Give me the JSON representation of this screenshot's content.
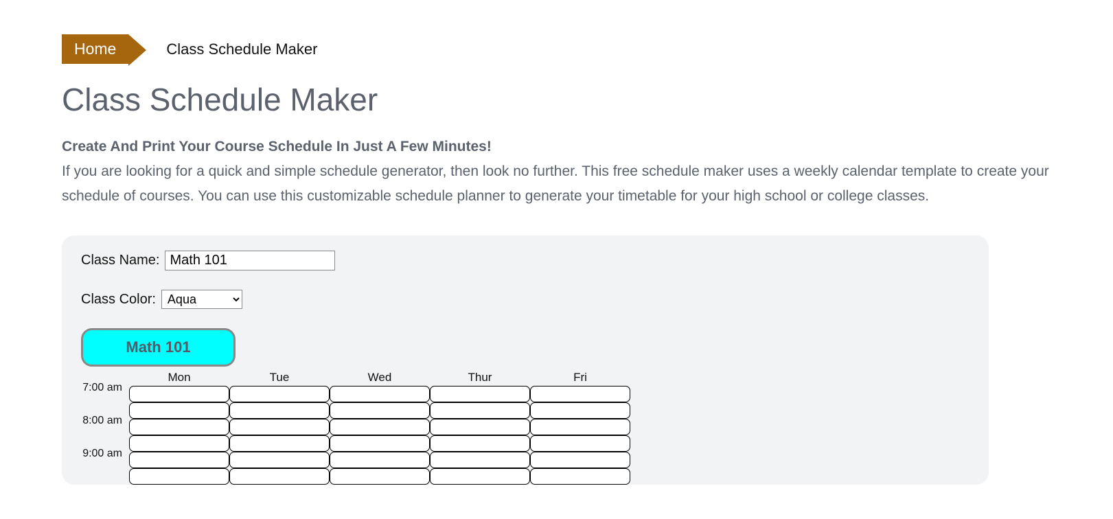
{
  "breadcrumb": {
    "home": "Home",
    "current": "Class Schedule Maker"
  },
  "title": "Class Schedule Maker",
  "tagline": "Create And Print Your Course Schedule In Just A Few Minutes!",
  "intro": "If you are looking for a quick and simple schedule generator, then look no further. This free schedule maker uses a weekly calendar template to create your schedule of courses. You can use this customizable schedule planner to generate your timetable for your high school or college classes.",
  "form": {
    "class_name_label": "Class Name:",
    "class_name_value": "Math 101",
    "class_color_label": "Class Color:",
    "class_color_value": "Aqua"
  },
  "pill": {
    "label": "Math 101",
    "color": "#00ffff"
  },
  "schedule": {
    "days": [
      "Mon",
      "Tue",
      "Wed",
      "Thur",
      "Fri"
    ],
    "times": [
      "7:00 am",
      "8:00 am",
      "9:00 am"
    ]
  }
}
